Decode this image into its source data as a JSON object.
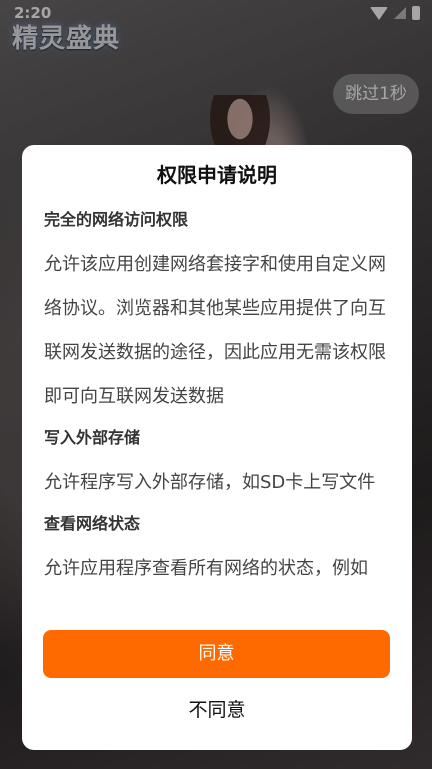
{
  "status_bar": {
    "time": "2:20"
  },
  "app": {
    "logo_text": "精灵盛典"
  },
  "skip_button": {
    "label": "跳过1秒"
  },
  "dialog": {
    "title": "权限申请说明",
    "permissions": [
      {
        "title": "完全的网络访问权限",
        "description": "允许该应用创建网络套接字和使用自定义网络协议。浏览器和其他某些应用提供了向互联网发送数据的途径，因此应用无需该权限即可向互联网发送数据"
      },
      {
        "title": "写入外部存储",
        "description": "允许程序写入外部存储，如SD卡上写文件"
      },
      {
        "title": "查看网络状态",
        "description": "允许应用程序查看所有网络的状态，例如"
      }
    ],
    "agree_label": "同意",
    "disagree_label": "不同意"
  },
  "colors": {
    "accent": "#ff6a00"
  },
  "icons": [
    "wifi-icon",
    "signal-icon",
    "battery-icon"
  ]
}
